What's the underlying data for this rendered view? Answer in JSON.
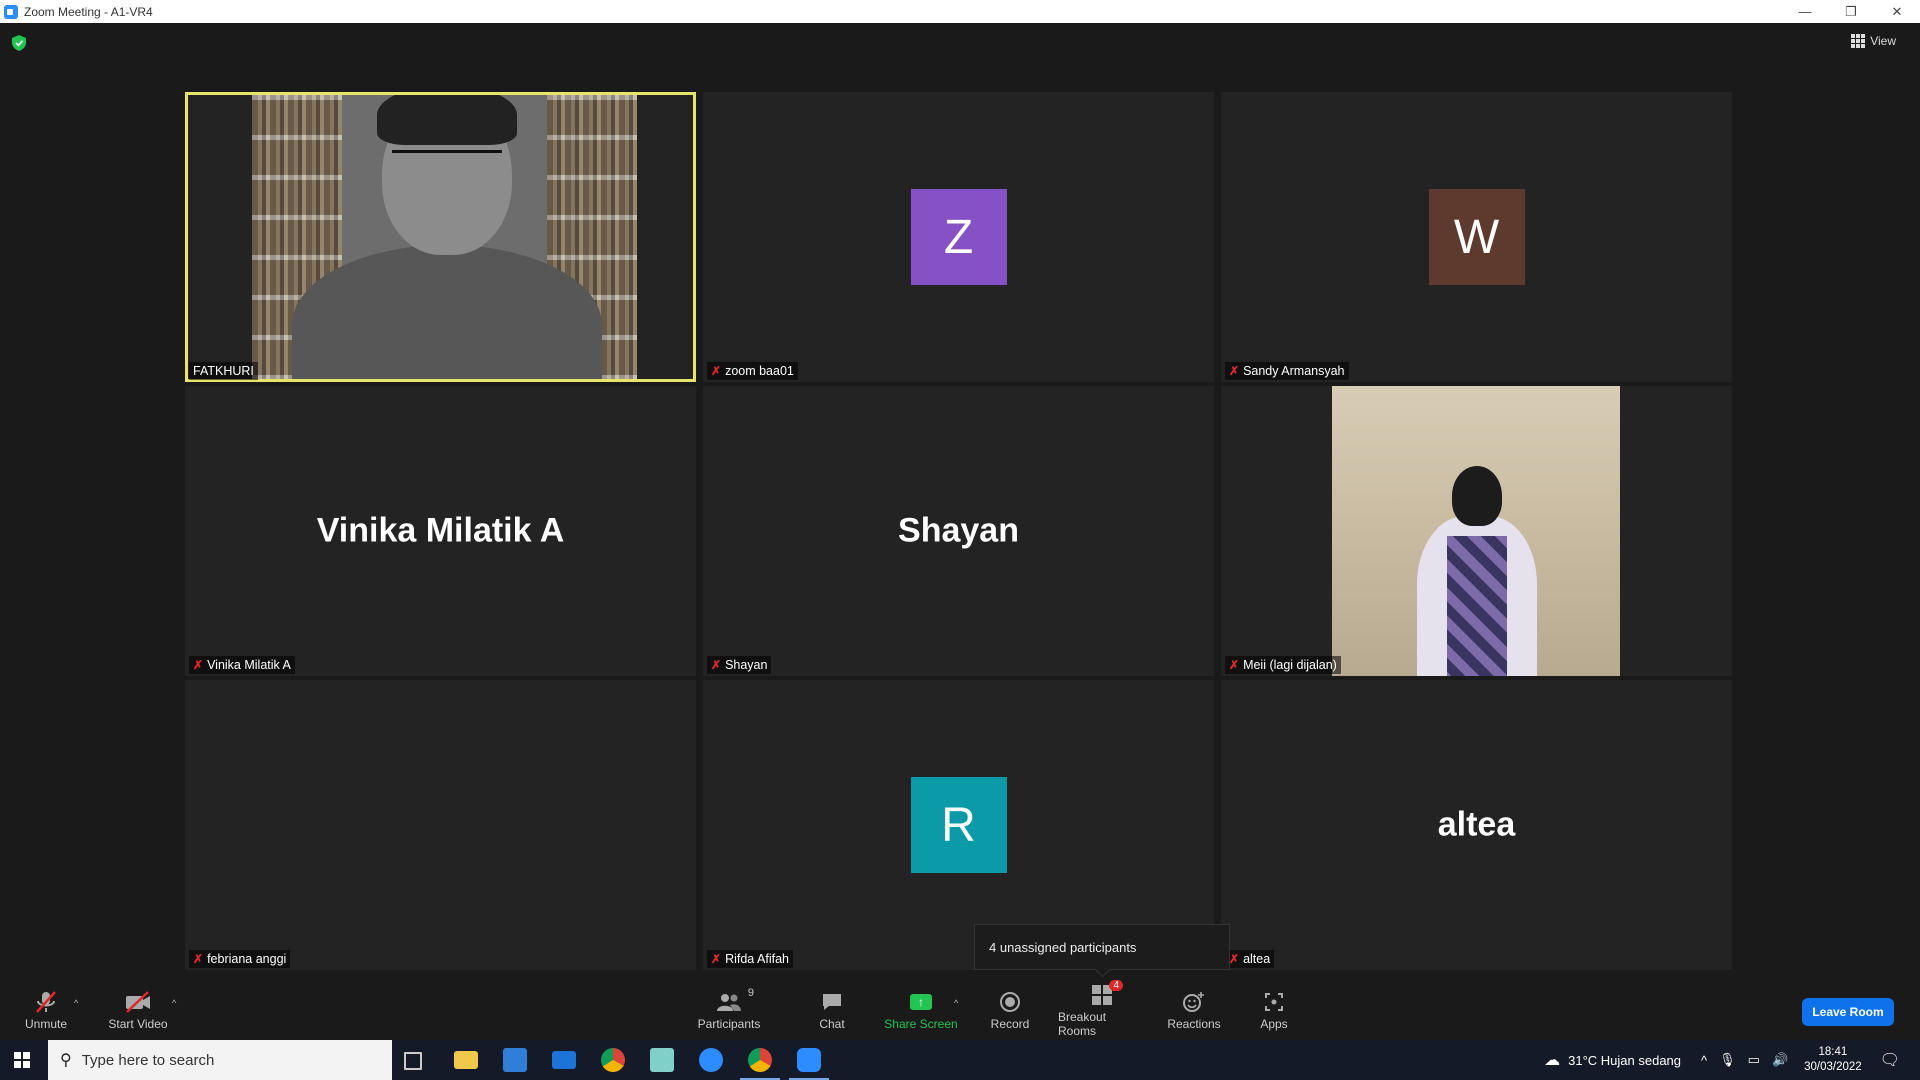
{
  "window": {
    "title": "Zoom Meeting - A1-VR4",
    "controls": [
      "—",
      "❐",
      "✕"
    ]
  },
  "view": {
    "label": "View"
  },
  "tiles": [
    {
      "name": "FATKHURI",
      "type": "video-speaker",
      "muted": false,
      "active": true
    },
    {
      "name": "zoom baa01",
      "type": "avatar",
      "initial": "Z",
      "color": "#8551c5",
      "muted": true
    },
    {
      "name": "Sandy Armansyah",
      "type": "avatar",
      "initial": "W",
      "color": "#5d3a2d",
      "muted": true
    },
    {
      "name": "Vinika Milatik A",
      "type": "bigname",
      "display": "Vinika Milatik A",
      "muted": true
    },
    {
      "name": "Shayan",
      "type": "bigname",
      "display": "Shayan",
      "muted": true
    },
    {
      "name": "Meii (lagi dijalan)",
      "type": "video-meii",
      "muted": true
    },
    {
      "name": "febriana anggi",
      "type": "blank",
      "muted": true
    },
    {
      "name": "Rifda Afifah",
      "type": "avatar",
      "initial": "R",
      "color": "#0b9aa8",
      "muted": true
    },
    {
      "name": "altea",
      "type": "bigname",
      "display": "altea",
      "muted": true
    }
  ],
  "tooltip": {
    "text": "4 unassigned participants"
  },
  "toolbar": {
    "unmute": "Unmute",
    "start_video": "Start Video",
    "participants": "Participants",
    "participants_count": "9",
    "chat": "Chat",
    "share_screen": "Share Screen",
    "record": "Record",
    "breakout_rooms": "Breakout Rooms",
    "breakout_badge": "4",
    "reactions": "Reactions",
    "apps": "Apps",
    "leave": "Leave Room"
  },
  "taskbar": {
    "search_placeholder": "Type here to search",
    "weather": "31°C  Hujan sedang",
    "time": "18:41",
    "date": "30/03/2022"
  },
  "colors": {
    "accent": "#0e72ed",
    "active_border": "#e6e46b",
    "muted": "#e02828",
    "share_green": "#23c552"
  }
}
